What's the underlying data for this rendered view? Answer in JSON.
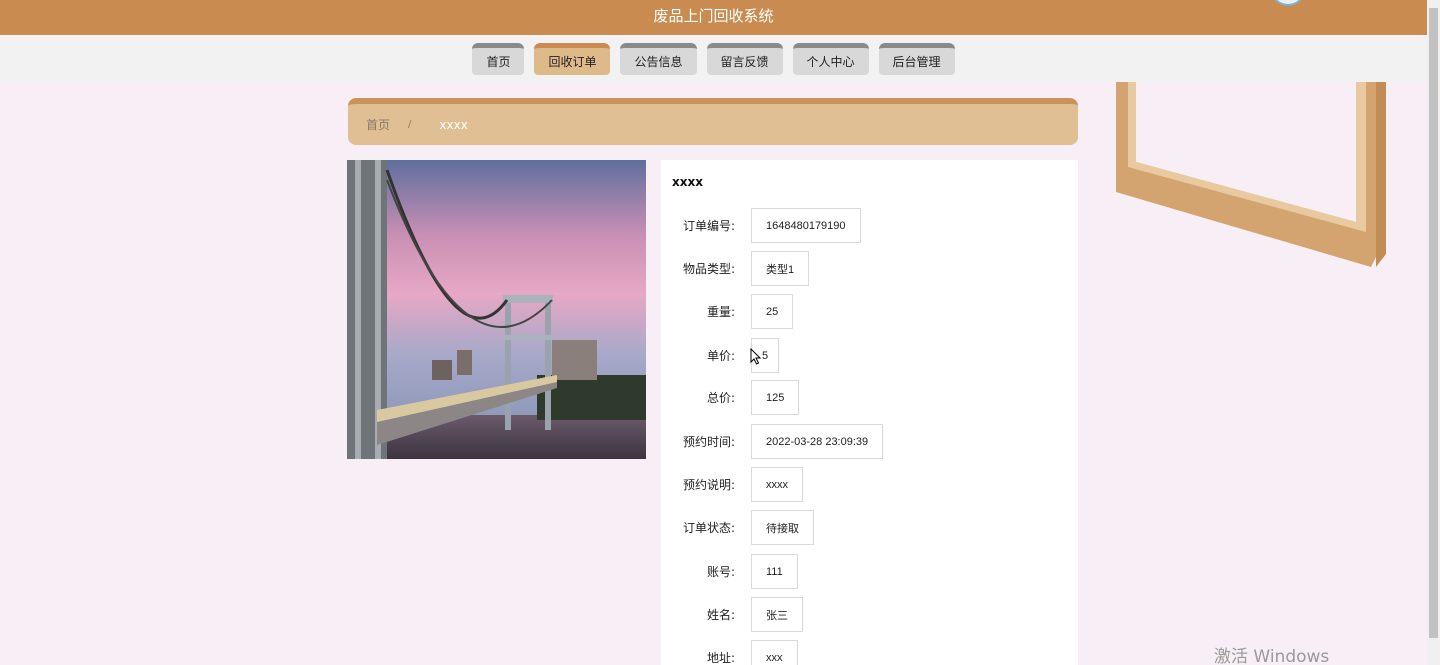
{
  "header": {
    "title": "废品上门回收系统"
  },
  "nav": {
    "items": [
      {
        "label": "首页",
        "active": false
      },
      {
        "label": "回收订单",
        "active": true
      },
      {
        "label": "公告信息",
        "active": false
      },
      {
        "label": "留言反馈",
        "active": false
      },
      {
        "label": "个人中心",
        "active": false
      },
      {
        "label": "后台管理",
        "active": false
      }
    ]
  },
  "breadcrumb": {
    "home": "首页",
    "separator": "/",
    "current": "xxxx"
  },
  "detail": {
    "title": "xxxx",
    "fields": [
      {
        "label": "订单编号:",
        "value": "1648480179190"
      },
      {
        "label": "物品类型:",
        "value": "类型1"
      },
      {
        "label": "重量:",
        "value": "25"
      },
      {
        "label": "单价:",
        "value": "5"
      },
      {
        "label": "总价:",
        "value": "125"
      },
      {
        "label": "预约时间:",
        "value": "2022-03-28 23:09:39"
      },
      {
        "label": "预约说明:",
        "value": "xxxx"
      },
      {
        "label": "订单状态:",
        "value": "待接取"
      },
      {
        "label": "账号:",
        "value": "111"
      },
      {
        "label": "姓名:",
        "value": "张三"
      },
      {
        "label": "地址:",
        "value": "xxx"
      }
    ]
  },
  "watermark": "激活 Windows",
  "colors": {
    "brand": "#c98b50",
    "accent": "#deb989",
    "background": "#f7eff5"
  },
  "image": {
    "subject": "suspension-bridge-photo"
  }
}
